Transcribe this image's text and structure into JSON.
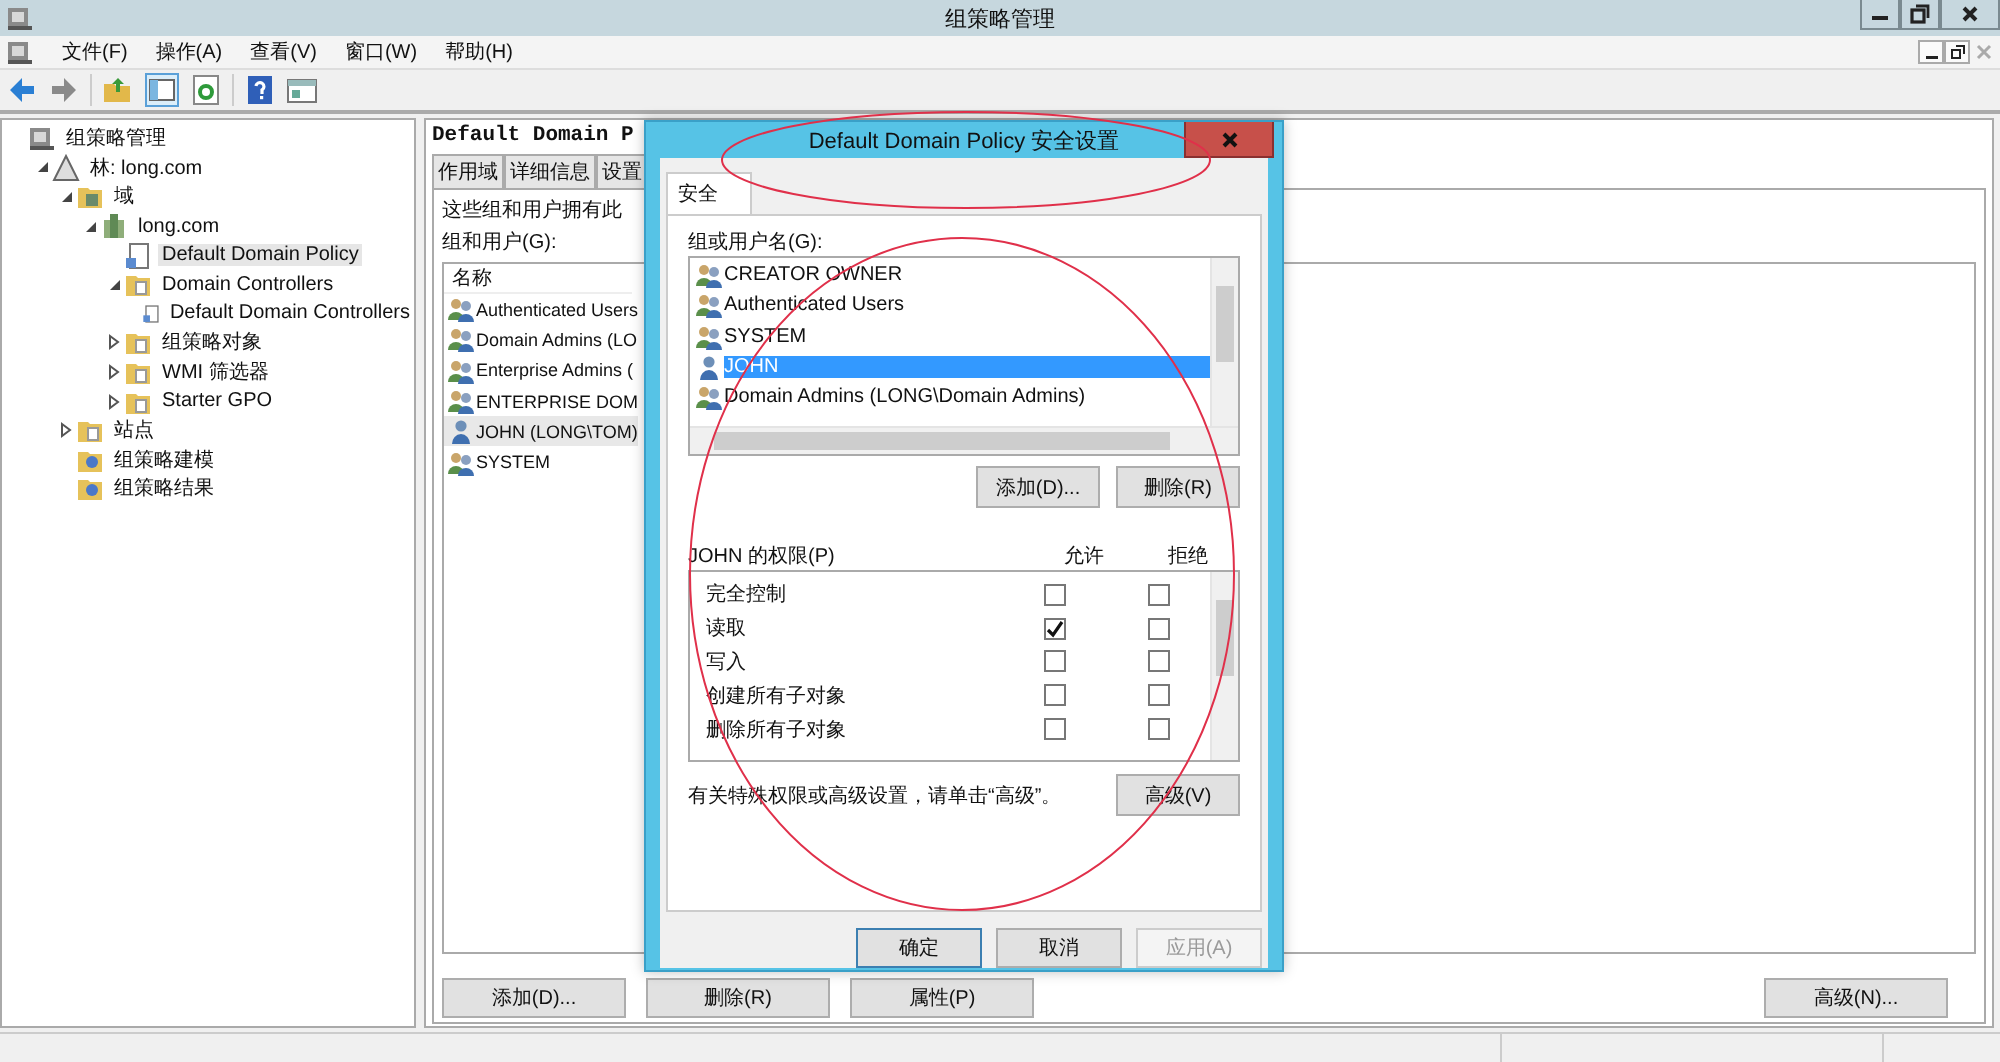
{
  "window": {
    "title": "组策略管理"
  },
  "menu": [
    "文件(F)",
    "操作(A)",
    "查看(V)",
    "窗口(W)",
    "帮助(H)"
  ],
  "tree": [
    {
      "label": "组策略管理",
      "kind": "console",
      "selected": false,
      "children": [
        {
          "label": "林: long.com",
          "kind": "forest",
          "expanded": true,
          "selected": false,
          "children": [
            {
              "label": "域",
              "kind": "domains",
              "expanded": true,
              "selected": false,
              "children": [
                {
                  "label": "long.com",
                  "kind": "domain",
                  "expanded": true,
                  "selected": false,
                  "children": [
                    {
                      "label": "Default Domain Policy",
                      "kind": "policy",
                      "selected": true
                    },
                    {
                      "label": "Domain Controllers",
                      "kind": "folder",
                      "expanded": true,
                      "selected": false,
                      "children": [
                        {
                          "label": "Default Domain Controllers",
                          "kind": "policy",
                          "selected": false
                        }
                      ]
                    },
                    {
                      "label": "组策略对象",
                      "kind": "folder",
                      "expanded": false,
                      "selected": false
                    },
                    {
                      "label": "WMI 筛选器",
                      "kind": "folder",
                      "expanded": false,
                      "selected": false
                    },
                    {
                      "label": "Starter GPO",
                      "kind": "folder",
                      "expanded": false,
                      "selected": false
                    }
                  ]
                }
              ]
            },
            {
              "label": "站点",
              "kind": "folder",
              "expanded": false,
              "selected": false
            },
            {
              "label": "组策略建模",
              "kind": "tool",
              "selected": false
            },
            {
              "label": "组策略结果",
              "kind": "tool",
              "selected": false
            }
          ]
        }
      ]
    }
  ],
  "detail": {
    "title": "Default Domain P",
    "tabs": [
      {
        "label": "作用域",
        "selected": false
      },
      {
        "label": "详细信息",
        "selected": false
      },
      {
        "label": "设置",
        "selected": false
      }
    ],
    "description": "这些组和用户拥有此",
    "list_label": "组和用户(G):",
    "column": "名称",
    "rows": [
      {
        "name": "Authenticated Users",
        "kind": "group",
        "selected": false
      },
      {
        "name": "Domain Admins (LO",
        "kind": "group",
        "selected": false
      },
      {
        "name": "Enterprise Admins (",
        "kind": "group",
        "selected": false
      },
      {
        "name": "ENTERPRISE DOM",
        "kind": "group",
        "selected": false
      },
      {
        "name": "JOHN (LONG\\TOM)",
        "kind": "user",
        "selected": true
      },
      {
        "name": "SYSTEM",
        "kind": "group",
        "selected": false
      }
    ],
    "buttons": [
      "添加(D)...",
      "删除(R)",
      "属性(P)"
    ],
    "right_button": "高级(N)..."
  },
  "dialog": {
    "title": "Default Domain Policy 安全设置",
    "tabs": [
      {
        "label": "安全",
        "selected": true
      }
    ],
    "principals_label": "组或用户名(G):",
    "principals": [
      {
        "name": "CREATOR OWNER",
        "kind": "group",
        "selected": false
      },
      {
        "name": "Authenticated Users",
        "kind": "group",
        "selected": false
      },
      {
        "name": "SYSTEM",
        "kind": "group",
        "selected": false
      },
      {
        "name": "JOHN",
        "kind": "user",
        "selected": true
      },
      {
        "name": "Domain Admins (LONG\\Domain Admins)",
        "kind": "group",
        "selected": false
      }
    ],
    "list_buttons": [
      "添加(D)...",
      "删除(R)"
    ],
    "permissions_label": "JOHN 的权限(P)",
    "allow_label": "允许",
    "deny_label": "拒绝",
    "permissions": [
      {
        "name": "完全控制",
        "allow": false,
        "deny": false
      },
      {
        "name": "读取",
        "allow": true,
        "deny": false
      },
      {
        "name": "写入",
        "allow": false,
        "deny": false
      },
      {
        "name": "创建所有子对象",
        "allow": false,
        "deny": false
      },
      {
        "name": "删除所有子对象",
        "allow": false,
        "deny": false
      }
    ],
    "note": "有关特殊权限或高级设置，请单击“高级”。",
    "advanced_button": "高级(V)",
    "buttons": [
      {
        "label": "确定",
        "disabled": false,
        "default": true
      },
      {
        "label": "取消",
        "disabled": false,
        "default": false
      },
      {
        "label": "应用(A)",
        "disabled": true,
        "default": false
      }
    ]
  }
}
